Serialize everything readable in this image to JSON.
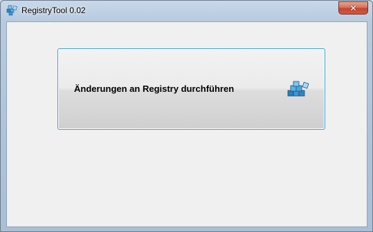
{
  "window": {
    "title": "RegistryTool 0.02",
    "close_label": "✕"
  },
  "main": {
    "action_button_label": "Änderungen an Registry durchführen"
  },
  "icons": {
    "app": "registry-cubes-icon",
    "action": "registry-cubes-icon"
  },
  "colors": {
    "accent_border": "#3c9fd6",
    "close_button": "#c7442b",
    "client_background": "#f0f0f0"
  }
}
